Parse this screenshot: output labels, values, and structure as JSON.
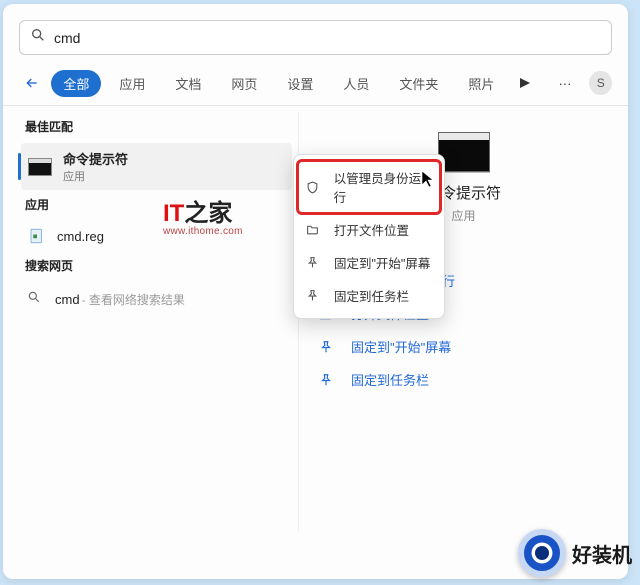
{
  "search": {
    "query": "cmd"
  },
  "tabs": {
    "items": [
      "全部",
      "应用",
      "文档",
      "网页",
      "设置",
      "人员",
      "文件夹",
      "照片"
    ],
    "active_index": 0
  },
  "avatar_letter": "S",
  "left": {
    "best_match_header": "最佳匹配",
    "best_item": {
      "title": "命令提示符",
      "subtitle": "应用"
    },
    "apps_header": "应用",
    "apps_item": {
      "title": "cmd.reg"
    },
    "web_header": "搜索网页",
    "web_item": {
      "query": "cmd",
      "hint": " - 查看网络搜索结果"
    }
  },
  "context_menu": {
    "items": [
      {
        "icon": "shield",
        "label": "以管理员身份运行",
        "highlighted": true
      },
      {
        "icon": "folder",
        "label": "打开文件位置"
      },
      {
        "icon": "pin",
        "label": "固定到\"开始\"屏幕"
      },
      {
        "icon": "pin",
        "label": "固定到任务栏"
      }
    ]
  },
  "preview": {
    "title": "命令提示符",
    "subtitle": "应用",
    "actions": [
      {
        "icon": "shield",
        "label": "以管理员身份运行"
      },
      {
        "icon": "folder",
        "label": "打开文件位置"
      },
      {
        "icon": "pin",
        "label": "固定到\"开始\"屏幕"
      },
      {
        "icon": "pin",
        "label": "固定到任务栏"
      }
    ]
  },
  "watermark": {
    "prefix": "IT",
    "suffix": "之家",
    "url": "www.ithome.com"
  },
  "brand": {
    "text": "好装机"
  }
}
